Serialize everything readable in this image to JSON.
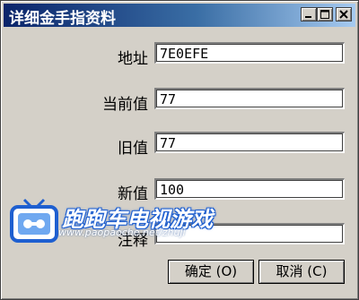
{
  "window": {
    "title": "详细金手指资料"
  },
  "icons": {
    "minimize": "minimize-icon",
    "maximize": "maximize-icon",
    "close": "close-icon",
    "logo": "game-controller-tv-logo"
  },
  "form": {
    "address": {
      "label": "地址",
      "value": "7E0EFE"
    },
    "current_value": {
      "label": "当前值",
      "value": "77"
    },
    "old_value": {
      "label": "旧值",
      "value": "77"
    },
    "new_value": {
      "label": "新值",
      "value": "100"
    },
    "comment": {
      "label": "注释",
      "value": ""
    }
  },
  "buttons": {
    "ok": "确定 (O)",
    "cancel": "取消 (C)"
  },
  "watermark": {
    "brand": "跑跑车电视游戏",
    "url": "www.paopaoche.net/zhuji"
  }
}
